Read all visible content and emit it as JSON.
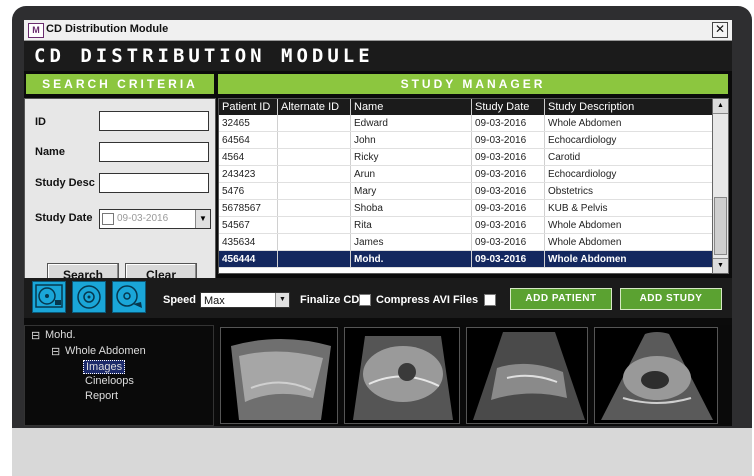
{
  "window": {
    "title": "CD Distribution Module",
    "app_icon": "M",
    "close": "✕"
  },
  "header": {
    "title": "CD DISTRIBUTION MODULE"
  },
  "search": {
    "heading": "SEARCH CRITERIA",
    "id_label": "ID",
    "name_label": "Name",
    "desc_label": "Study Desc",
    "date_label": "Study Date",
    "date_value": "09-03-2016",
    "search_button": "Search",
    "clear_button": "Clear"
  },
  "study": {
    "heading": "STUDY MANAGER",
    "columns": [
      "Patient ID",
      "Alternate ID",
      "Name",
      "Study Date",
      "Study Description"
    ],
    "rows": [
      [
        "32465",
        "",
        "Edward",
        "09-03-2016",
        "Whole Abdomen"
      ],
      [
        "64564",
        "",
        "John",
        "09-03-2016",
        "Echocardiology"
      ],
      [
        "4564",
        "",
        "Ricky",
        "09-03-2016",
        "Carotid"
      ],
      [
        "243423",
        "",
        "Arun",
        "09-03-2016",
        "Echocardiology"
      ],
      [
        "5476",
        "",
        "Mary",
        "09-03-2016",
        "Obstetrics"
      ],
      [
        "5678567",
        "",
        "Shoba",
        "09-03-2016",
        "KUB & Pelvis"
      ],
      [
        "54567",
        "",
        "Rita",
        "09-03-2016",
        "Whole Abdomen"
      ],
      [
        "435634",
        "",
        "James",
        "09-03-2016",
        "Whole Abdomen"
      ],
      [
        "456444",
        "",
        "Mohd.",
        "09-03-2016",
        "Whole Abdomen"
      ]
    ],
    "selected_row": 8
  },
  "toolbar": {
    "speed_label": "Speed",
    "speed_value": "Max",
    "finalize_label": "Finalize CD",
    "compress_label": "Compress AVI Files",
    "add_patient": "ADD PATIENT",
    "add_study": "ADD STUDY"
  },
  "tree": {
    "patient": "Mohd.",
    "study": "Whole Abdomen",
    "images": "Images",
    "cineloops": "Cineloops",
    "report": "Report",
    "expanded": "⊟"
  },
  "colors": {
    "accent_green": "#8cc63f",
    "button_green": "#5ba231",
    "selection_blue": "#14285f",
    "disc_blue": "#1aa6d8"
  }
}
